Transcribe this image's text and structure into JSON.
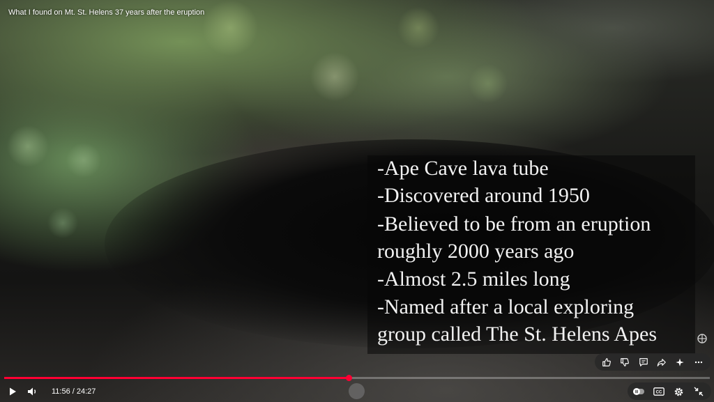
{
  "video": {
    "title": "What I found on Mt. St. Helens 37 years after the eruption"
  },
  "caption": {
    "lines": [
      "-Ape Cave lava tube",
      "-Discovered around 1950",
      "-Believed to be from an eruption",
      "roughly 2000 years ago",
      "-Almost 2.5 miles long",
      "-Named after a local exploring",
      "group called The St. Helens Apes"
    ]
  },
  "actions": {
    "icons": [
      "thumbs-up-icon",
      "thumbs-down-icon",
      "comment-icon",
      "share-icon",
      "sparkle-icon",
      "more-icon"
    ]
  },
  "player": {
    "current_time": "11:56",
    "duration": "24:27",
    "time_display": "11:56 / 24:27",
    "progress_fraction": 0.488,
    "accent_color": "#ff0033",
    "icons": [
      "play-icon",
      "volume-icon",
      "autoplay-toggle-icon",
      "captions-icon",
      "settings-icon",
      "exit-fullscreen-icon"
    ],
    "captions_label": "CC"
  }
}
